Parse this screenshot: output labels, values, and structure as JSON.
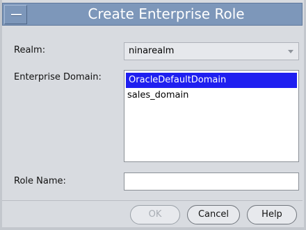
{
  "window": {
    "title": "Create Enterprise Role"
  },
  "form": {
    "realm_label": "Realm:",
    "realm_value": "ninarealm",
    "domain_label": "Enterprise Domain:",
    "domains": [
      "OracleDefaultDomain",
      "sales_domain"
    ],
    "selected_domain": "OracleDefaultDomain",
    "role_name_label": "Role Name:",
    "role_name_value": ""
  },
  "buttons": {
    "ok": "OK",
    "cancel": "Cancel",
    "help": "Help"
  },
  "colors": {
    "titlebar": "#7d97ba",
    "selection": "#1f1ff0",
    "dialog_bg": "#d8dbe0"
  }
}
